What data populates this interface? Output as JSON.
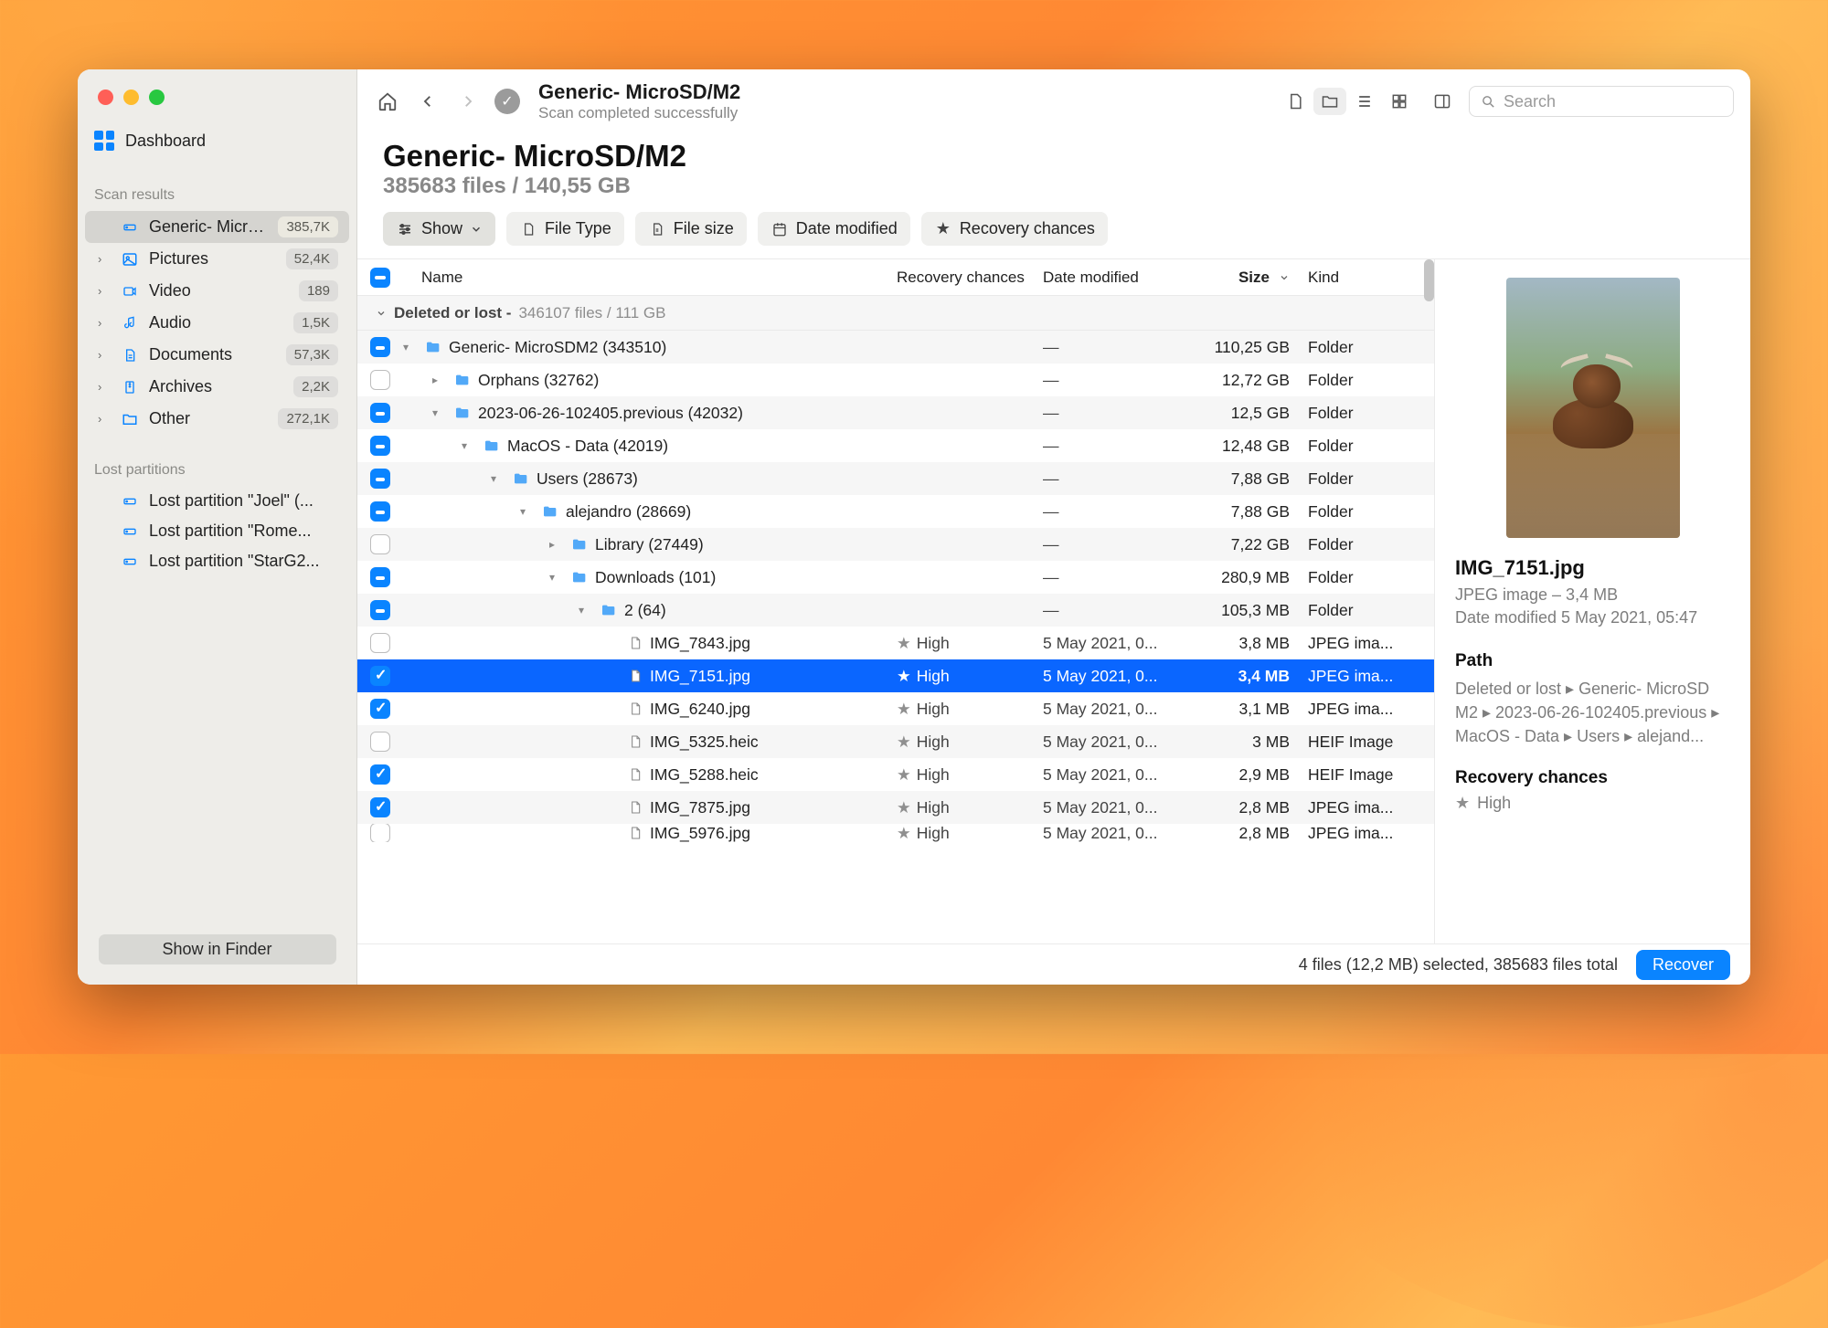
{
  "sidebar": {
    "dashboard": "Dashboard",
    "scan_results_title": "Scan results",
    "items": [
      {
        "label": "Generic- Micro...",
        "count": "385,7K",
        "icon": "drive",
        "active": true,
        "chev": ""
      },
      {
        "label": "Pictures",
        "count": "52,4K",
        "icon": "picture",
        "chev": "›"
      },
      {
        "label": "Video",
        "count": "189",
        "icon": "video",
        "chev": "›"
      },
      {
        "label": "Audio",
        "count": "1,5K",
        "icon": "audio",
        "chev": "›"
      },
      {
        "label": "Documents",
        "count": "57,3K",
        "icon": "document",
        "chev": "›"
      },
      {
        "label": "Archives",
        "count": "2,2K",
        "icon": "archive",
        "chev": "›"
      },
      {
        "label": "Other",
        "count": "272,1K",
        "icon": "other",
        "chev": "›"
      }
    ],
    "lost_title": "Lost partitions",
    "lost": [
      {
        "label": "Lost partition \"Joel\" (..."
      },
      {
        "label": "Lost partition \"Rome..."
      },
      {
        "label": "Lost partition \"StarG2..."
      }
    ],
    "finder_btn": "Show in Finder"
  },
  "toolbar": {
    "title": "Generic- MicroSD/M2",
    "subtitle": "Scan completed successfully",
    "search_placeholder": "Search"
  },
  "heading": {
    "title": "Generic- MicroSD/M2",
    "subtitle": "385683 files / 140,55 GB"
  },
  "filters": {
    "show": "Show",
    "file_type": "File Type",
    "file_size": "File size",
    "date_modified": "Date modified",
    "recovery_chances": "Recovery chances"
  },
  "table": {
    "headers": {
      "name": "Name",
      "recovery": "Recovery chances",
      "date": "Date modified",
      "size": "Size",
      "kind": "Kind"
    },
    "group_title": "Deleted or lost - ",
    "group_meta": "346107 files / 111 GB",
    "rows": [
      {
        "depth": 0,
        "check": "indet",
        "chev": "v",
        "type": "folder",
        "name": "Generic- MicroSDM2 (343510)",
        "rec": "",
        "date": "—",
        "size": "110,25 GB",
        "kind": "Folder",
        "alt": true
      },
      {
        "depth": 1,
        "check": "empty",
        "chev": ">",
        "type": "folder",
        "name": "Orphans (32762)",
        "rec": "",
        "date": "—",
        "size": "12,72 GB",
        "kind": "Folder"
      },
      {
        "depth": 1,
        "check": "indet",
        "chev": "v",
        "type": "folder",
        "name": "2023-06-26-102405.previous (42032)",
        "rec": "",
        "date": "—",
        "size": "12,5 GB",
        "kind": "Folder",
        "alt": true
      },
      {
        "depth": 2,
        "check": "indet",
        "chev": "v",
        "type": "folder",
        "name": "MacOS - Data (42019)",
        "rec": "",
        "date": "—",
        "size": "12,48 GB",
        "kind": "Folder"
      },
      {
        "depth": 3,
        "check": "indet",
        "chev": "v",
        "type": "folder",
        "name": "Users (28673)",
        "rec": "",
        "date": "—",
        "size": "7,88 GB",
        "kind": "Folder",
        "alt": true
      },
      {
        "depth": 4,
        "check": "indet",
        "chev": "v",
        "type": "folder",
        "name": "alejandro (28669)",
        "rec": "",
        "date": "—",
        "size": "7,88 GB",
        "kind": "Folder"
      },
      {
        "depth": 5,
        "check": "empty",
        "chev": ">",
        "type": "folder",
        "name": "Library (27449)",
        "rec": "",
        "date": "—",
        "size": "7,22 GB",
        "kind": "Folder",
        "alt": true
      },
      {
        "depth": 5,
        "check": "indet",
        "chev": "v",
        "type": "folder",
        "name": "Downloads (101)",
        "rec": "",
        "date": "—",
        "size": "280,9 MB",
        "kind": "Folder"
      },
      {
        "depth": 6,
        "check": "indet",
        "chev": "v",
        "type": "folder",
        "name": "2 (64)",
        "rec": "",
        "date": "—",
        "size": "105,3 MB",
        "kind": "Folder",
        "alt": true
      },
      {
        "depth": 7,
        "check": "empty",
        "chev": "",
        "type": "file",
        "name": "IMG_7843.jpg",
        "rec": "High",
        "date": "5 May 2021, 0...",
        "size": "3,8 MB",
        "kind": "JPEG ima..."
      },
      {
        "depth": 7,
        "check": "checked",
        "chev": "",
        "type": "file",
        "name": "IMG_7151.jpg",
        "rec": "High",
        "date": "5 May 2021, 0...",
        "size": "3,4 MB",
        "kind": "JPEG ima...",
        "selected": true
      },
      {
        "depth": 7,
        "check": "checked",
        "chev": "",
        "type": "file",
        "name": "IMG_6240.jpg",
        "rec": "High",
        "date": "5 May 2021, 0...",
        "size": "3,1 MB",
        "kind": "JPEG ima..."
      },
      {
        "depth": 7,
        "check": "empty",
        "chev": "",
        "type": "file",
        "name": "IMG_5325.heic",
        "rec": "High",
        "date": "5 May 2021, 0...",
        "size": "3 MB",
        "kind": "HEIF Image",
        "alt": true
      },
      {
        "depth": 7,
        "check": "checked",
        "chev": "",
        "type": "file",
        "name": "IMG_5288.heic",
        "rec": "High",
        "date": "5 May 2021, 0...",
        "size": "2,9 MB",
        "kind": "HEIF Image"
      },
      {
        "depth": 7,
        "check": "checked",
        "chev": "",
        "type": "file",
        "name": "IMG_7875.jpg",
        "rec": "High",
        "date": "5 May 2021, 0...",
        "size": "2,8 MB",
        "kind": "JPEG ima...",
        "alt": true
      },
      {
        "depth": 7,
        "check": "empty",
        "chev": "",
        "type": "file",
        "name": "IMG_5976.jpg",
        "rec": "High",
        "date": "5 May 2021, 0...",
        "size": "2,8 MB",
        "kind": "JPEG ima...",
        "cut": true
      }
    ]
  },
  "preview": {
    "name": "IMG_7151.jpg",
    "meta": "JPEG image – 3,4 MB",
    "date": "Date modified 5 May 2021, 05:47",
    "path_label": "Path",
    "path": "Deleted or lost ▸ Generic- MicroSD M2 ▸ 2023-06-26-102405.previous ▸ MacOS - Data ▸ Users ▸ alejand...",
    "rec_label": "Recovery chances",
    "rec_value": "High"
  },
  "status": {
    "text": "4 files (12,2 MB) selected, 385683 files total",
    "recover": "Recover"
  }
}
